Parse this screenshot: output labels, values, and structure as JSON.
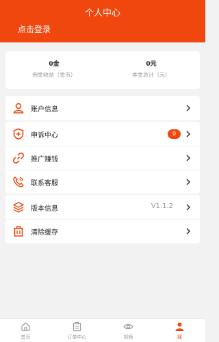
{
  "header": {
    "title": "个人中心",
    "login_label": "点击登录",
    "background": "#f0470f"
  },
  "stats": [
    {
      "value": "0金",
      "label": "佣金收益（金币）"
    },
    {
      "value": "0元",
      "label": "本金总计（元）"
    }
  ],
  "account_group": {
    "items": [
      {
        "label": "账户信息",
        "icon": "user-icon"
      }
    ]
  },
  "service_group": {
    "items": [
      {
        "label": "申诉中心",
        "icon": "shield-plus-icon",
        "badge": "0"
      },
      {
        "label": "推广赚钱",
        "icon": "link-icon"
      },
      {
        "label": "联系客服",
        "icon": "phone-icon"
      }
    ]
  },
  "system_group": {
    "items": [
      {
        "label": "版本信息",
        "icon": "layers-icon",
        "value": "V1.1.2"
      },
      {
        "label": "清除缓存",
        "icon": "trash-icon"
      }
    ]
  },
  "tabs": [
    {
      "label": "首页",
      "icon": "home-icon",
      "active": false
    },
    {
      "label": "订单中心",
      "icon": "clipboard-icon",
      "active": false
    },
    {
      "label": "视频",
      "icon": "eye-icon",
      "active": false
    },
    {
      "label": "我",
      "icon": "person-icon",
      "active": true
    }
  ],
  "accent_color": "#f0470f"
}
